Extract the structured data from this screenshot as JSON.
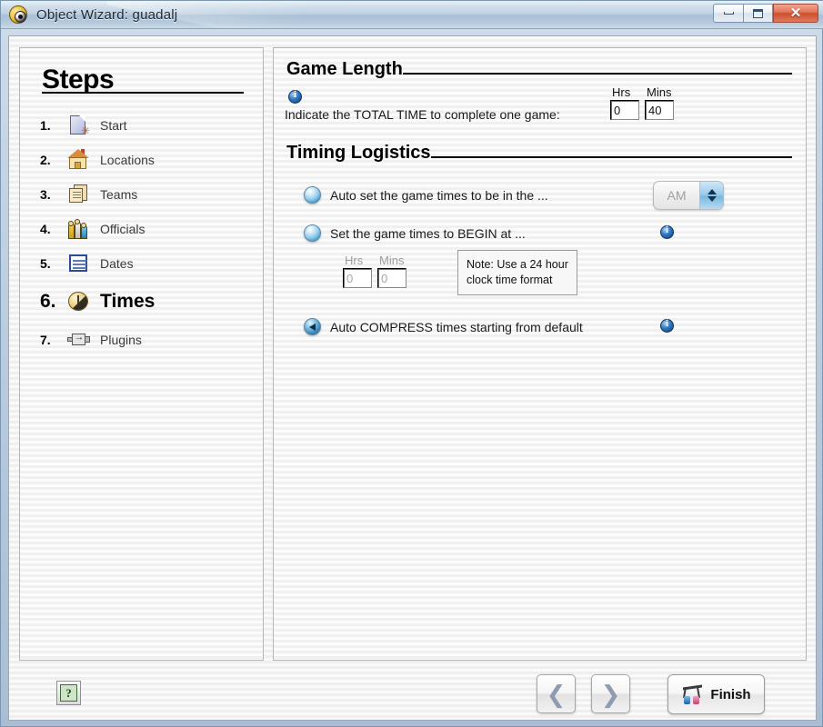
{
  "window": {
    "title": "Object Wizard: guadalj",
    "app_icon": "clock-ball-icon",
    "buttons": {
      "minimize": "minimize-icon",
      "maximize": "maximize-icon",
      "close": "✕"
    }
  },
  "sidebar": {
    "heading": "Steps",
    "items": [
      {
        "num": "1.",
        "label": "Start",
        "icon": "document-star-icon",
        "active": false
      },
      {
        "num": "2.",
        "label": "Locations",
        "icon": "house-icon",
        "active": false
      },
      {
        "num": "3.",
        "label": "Teams",
        "icon": "cards-icon",
        "active": false
      },
      {
        "num": "4.",
        "label": "Officials",
        "icon": "people-icon",
        "active": false
      },
      {
        "num": "5.",
        "label": "Dates",
        "icon": "calendar-icon",
        "active": false
      },
      {
        "num": "6.",
        "label": "Times",
        "icon": "clock-icon",
        "active": true
      },
      {
        "num": "7.",
        "label": "Plugins",
        "icon": "plug-icon",
        "active": false
      }
    ]
  },
  "main": {
    "game_length": {
      "heading": "Game Length",
      "info_icon": "info-icon",
      "description": "Indicate the TOTAL TIME to complete one game:",
      "hrs_label": "Hrs",
      "mins_label": "Mins",
      "hrs_value": "0",
      "mins_value": "40"
    },
    "timing_logistics": {
      "heading": "Timing Logistics",
      "option_ampm": {
        "label": "Auto set the game times to be in the ...",
        "selected": false,
        "ampm_value": "AM",
        "ampm_disabled": true
      },
      "option_begin": {
        "label": "Set the game times to BEGIN at ...",
        "selected": false,
        "info_icon": "info-icon",
        "hrs_label": "Hrs",
        "mins_label": "Mins",
        "hrs_value": "0",
        "mins_value": "0",
        "note_line1": "Note: Use a 24 hour",
        "note_line2": "clock time format"
      },
      "option_compress": {
        "label": "Auto COMPRESS times starting from default",
        "selected": true,
        "info_icon": "info-icon"
      }
    }
  },
  "footer": {
    "help_label": "?",
    "back_label": "❮",
    "next_label": "❯",
    "finish_label": "Finish",
    "finish_icon": "finish-flag-icon"
  }
}
